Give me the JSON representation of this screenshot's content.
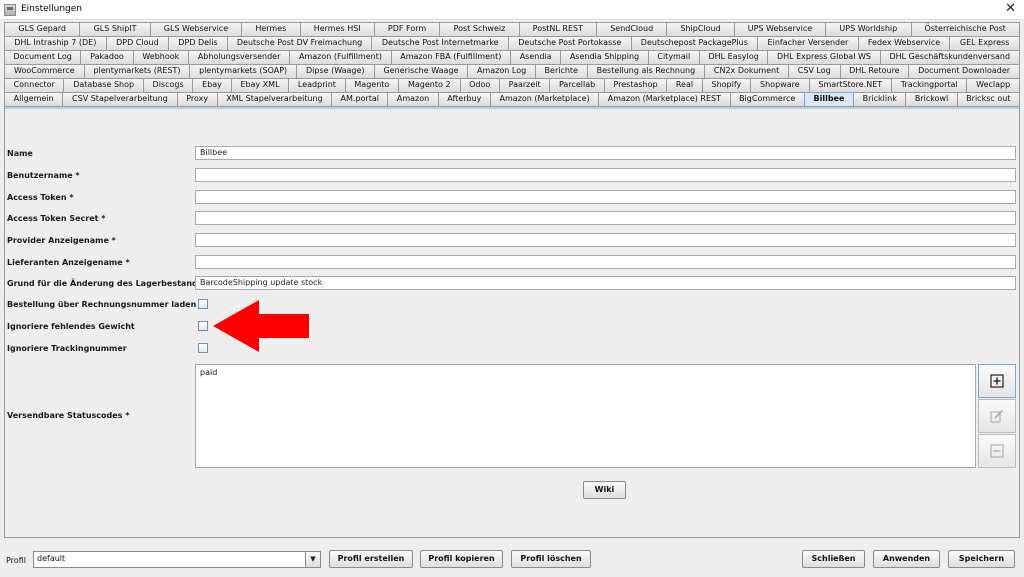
{
  "window": {
    "title": "Einstellungen",
    "close_glyph": "✕"
  },
  "tabs": {
    "rows": [
      [
        "GLS Gepard",
        "GLS ShipIT",
        "GLS Webservice",
        "Hermes",
        "Hermes HSI",
        "PDF Form",
        "Post Schweiz",
        "PostNL REST",
        "SendCloud",
        "ShipCloud",
        "UPS Webservice",
        "UPS Worldship",
        "Österreichische Post"
      ],
      [
        "DHL Intraship 7 (DE)",
        "DPD Cloud",
        "DPD Delis",
        "Deutsche Post DV Freimachung",
        "Deutsche Post Internetmarke",
        "Deutsche Post Portokasse",
        "Deutschepost PackagePlus",
        "Einfacher Versender",
        "Fedex Webservice",
        "GEL Express"
      ],
      [
        "Document Log",
        "Pakadoo",
        "Webhook",
        "Abholungsversender",
        "Amazon (Fulfillment)",
        "Amazon FBA (Fulfillment)",
        "Asendia",
        "Asendia Shipping",
        "Citymail",
        "DHL Easylog",
        "DHL Express Global WS",
        "DHL Geschäftskundenversand"
      ],
      [
        "WooCommerce",
        "plentymarkets (REST)",
        "plentymarkets (SOAP)",
        "Dipse (Waage)",
        "Generische Waage",
        "Amazon Log",
        "Berichte",
        "Bestellung als Rechnung",
        "CN2x Dokument",
        "CSV Log",
        "DHL Retoure",
        "Document Downloader"
      ],
      [
        "Connector",
        "Database Shop",
        "Discogs",
        "Ebay",
        "Ebay XML",
        "Leadprint",
        "Magento",
        "Magento 2",
        "Odoo",
        "Paarzeit",
        "Parcellab",
        "Prestashop",
        "Real",
        "Shopify",
        "Shopware",
        "SmartStore.NET",
        "Trackingportal",
        "Weclapp"
      ],
      [
        "Allgemein",
        "CSV Stapelverarbeitung",
        "Proxy",
        "XML Stapelverarbeitung",
        "AM.portal",
        "Amazon",
        "Afterbuy",
        "Amazon (Marketplace)",
        "Amazon (Marketplace) REST",
        "BigCommerce",
        "Billbee",
        "Bricklink",
        "Brickowl",
        "Bricksc out"
      ]
    ],
    "selected": "Billbee"
  },
  "form": {
    "name_label": "Name",
    "name_value": "Billbee",
    "benutzername_label": "Benutzername *",
    "benutzername_value": "",
    "access_token_label": "Access Token *",
    "access_token_value": "",
    "access_token_secret_label": "Access Token Secret *",
    "access_token_secret_value": "",
    "provider_label": "Provider Anzeigename *",
    "provider_value": "",
    "lieferanten_label": "Lieferanten Anzeigename *",
    "lieferanten_value": "",
    "grund_label": "Grund für die Änderung des Lagerbestandes",
    "grund_value": "BarcodeShipping update stock",
    "bestellung_label": "Bestellung über Rechnungsnummer laden",
    "bestellung_checked": false,
    "ignoriere_gewicht_label": "Ignoriere fehlendes Gewicht",
    "ignoriere_gewicht_checked": false,
    "ignoriere_tracking_label": "Ignoriere Trackingnummer",
    "ignoriere_tracking_checked": false,
    "statuscodes_label": "Versendbare Statuscodes *",
    "statuscodes_value": "paid",
    "wiki_button": "Wiki"
  },
  "side_buttons": {
    "add_icon": "add-icon",
    "edit_icon": "edit-icon",
    "remove_icon": "remove-icon"
  },
  "annotation": {
    "arrow_color": "#ff0000"
  },
  "bottom": {
    "profil_label": "Profil",
    "profil_value": "default",
    "profil_erstellen": "Profil erstellen",
    "profil_kopieren": "Profil kopieren",
    "profil_loeschen": "Profil löschen",
    "schliessen": "Schließen",
    "anwenden": "Anwenden",
    "speichern": "Speichern"
  },
  "colors": {
    "selected_tab": "#dbe7f5",
    "panel_bg": "#eeeeee"
  }
}
